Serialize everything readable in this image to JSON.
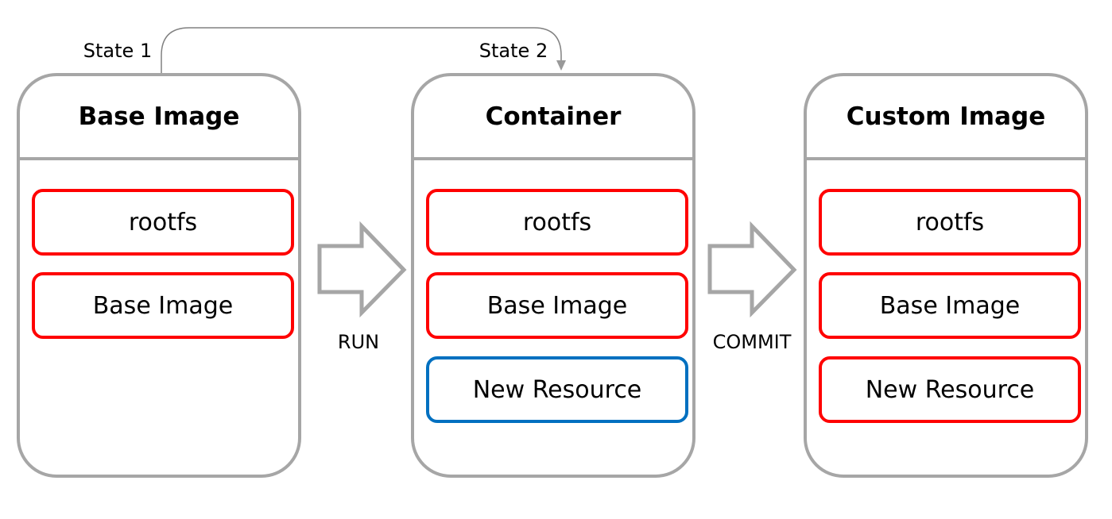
{
  "colors": {
    "outline": "#a6a6a6",
    "layer": "#ff0000",
    "new_layer": "#0070c0",
    "connector": "#808080"
  },
  "connector": {
    "from_label": "State 1",
    "to_label": "State 2"
  },
  "panels": [
    {
      "title": "Base Image",
      "items": [
        {
          "label": "rootfs",
          "kind": "existing"
        },
        {
          "label": "Base Image",
          "kind": "existing"
        }
      ]
    },
    {
      "title": "Container",
      "items": [
        {
          "label": "rootfs",
          "kind": "existing"
        },
        {
          "label": "Base Image",
          "kind": "existing"
        },
        {
          "label": "New Resource",
          "kind": "new"
        }
      ]
    },
    {
      "title": "Custom Image",
      "items": [
        {
          "label": "rootfs",
          "kind": "existing"
        },
        {
          "label": "Base Image",
          "kind": "existing"
        },
        {
          "label": "New Resource",
          "kind": "existing"
        }
      ]
    }
  ],
  "transitions": [
    {
      "label": "RUN"
    },
    {
      "label": "COMMIT"
    }
  ]
}
